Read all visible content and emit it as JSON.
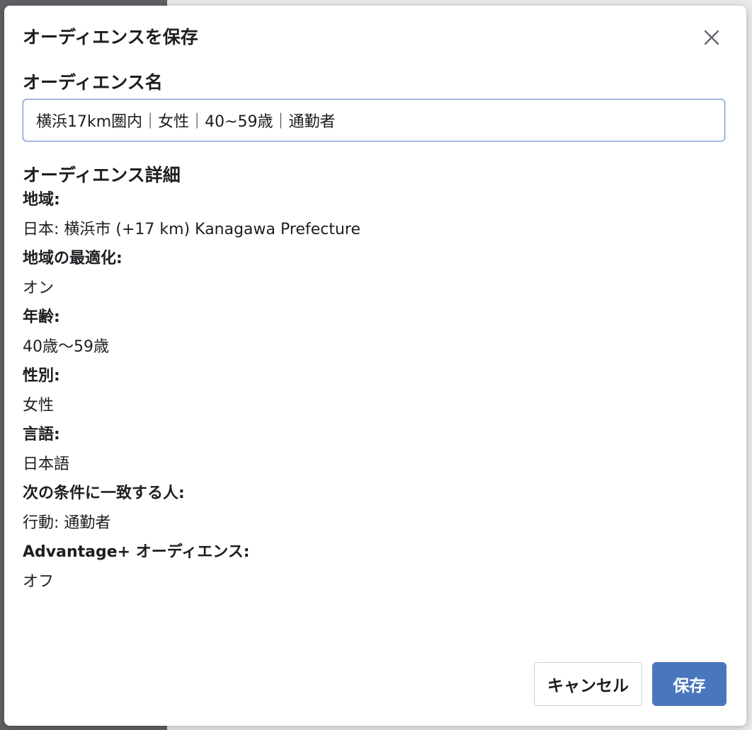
{
  "dialog": {
    "title": "オーディエンスを保存",
    "close_icon": "close-icon"
  },
  "name_section": {
    "label": "オーディエンス名",
    "input_value": "横浜17km圏内｜女性｜40~59歳｜通勤者"
  },
  "details_section": {
    "label": "オーディエンス詳細",
    "items": [
      {
        "key": "地域:",
        "value": "日本: 横浜市 (+17 km) Kanagawa Prefecture"
      },
      {
        "key": "地域の最適化:",
        "value": "オン"
      },
      {
        "key": "年齢:",
        "value": "40歳〜59歳"
      },
      {
        "key": "性別:",
        "value": "女性"
      },
      {
        "key": "言語:",
        "value": "日本語"
      },
      {
        "key": "次の条件に一致する人:",
        "value": "行動: 通勤者"
      },
      {
        "key": "Advantage+ オーディエンス:",
        "value": "オフ"
      }
    ]
  },
  "footer": {
    "cancel_label": "キャンセル",
    "save_label": "保存",
    "save_color": "#4a76bd"
  }
}
